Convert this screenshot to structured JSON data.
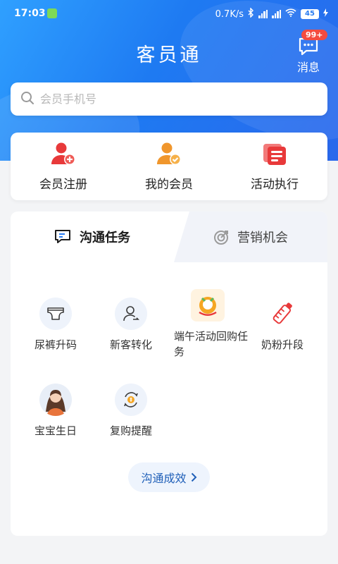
{
  "status_bar": {
    "time": "17:03",
    "network_speed": "0.7K/s",
    "battery": "45"
  },
  "header": {
    "title": "客员通",
    "message_label": "消息",
    "message_badge": "99+"
  },
  "search": {
    "placeholder": "会员手机号",
    "value": ""
  },
  "quick_actions": [
    {
      "label": "会员注册",
      "icon": "user-add-icon"
    },
    {
      "label": "我的会员",
      "icon": "user-check-icon"
    },
    {
      "label": "活动执行",
      "icon": "activity-icon"
    }
  ],
  "tabs": [
    {
      "label": "沟通任务",
      "icon": "chat-square-icon",
      "active": true
    },
    {
      "label": "营销机会",
      "icon": "target-icon",
      "active": false
    }
  ],
  "tasks": [
    {
      "label": "尿裤升码",
      "icon": "diaper-icon"
    },
    {
      "label": "新客转化",
      "icon": "user-convert-icon"
    },
    {
      "label": "端午活动回购任务",
      "icon": "dragon-boat-icon"
    },
    {
      "label": "奶粉升段",
      "icon": "milk-bottle-icon"
    },
    {
      "label": "宝宝生日",
      "icon": "baby-avatar-icon"
    },
    {
      "label": "复购提醒",
      "icon": "repurchase-icon"
    }
  ],
  "effect_button": {
    "label": "沟通成效"
  },
  "colors": {
    "brand_blue": "#1e7af2",
    "accent_red": "#f44b3f",
    "accent_orange": "#f5a623"
  }
}
